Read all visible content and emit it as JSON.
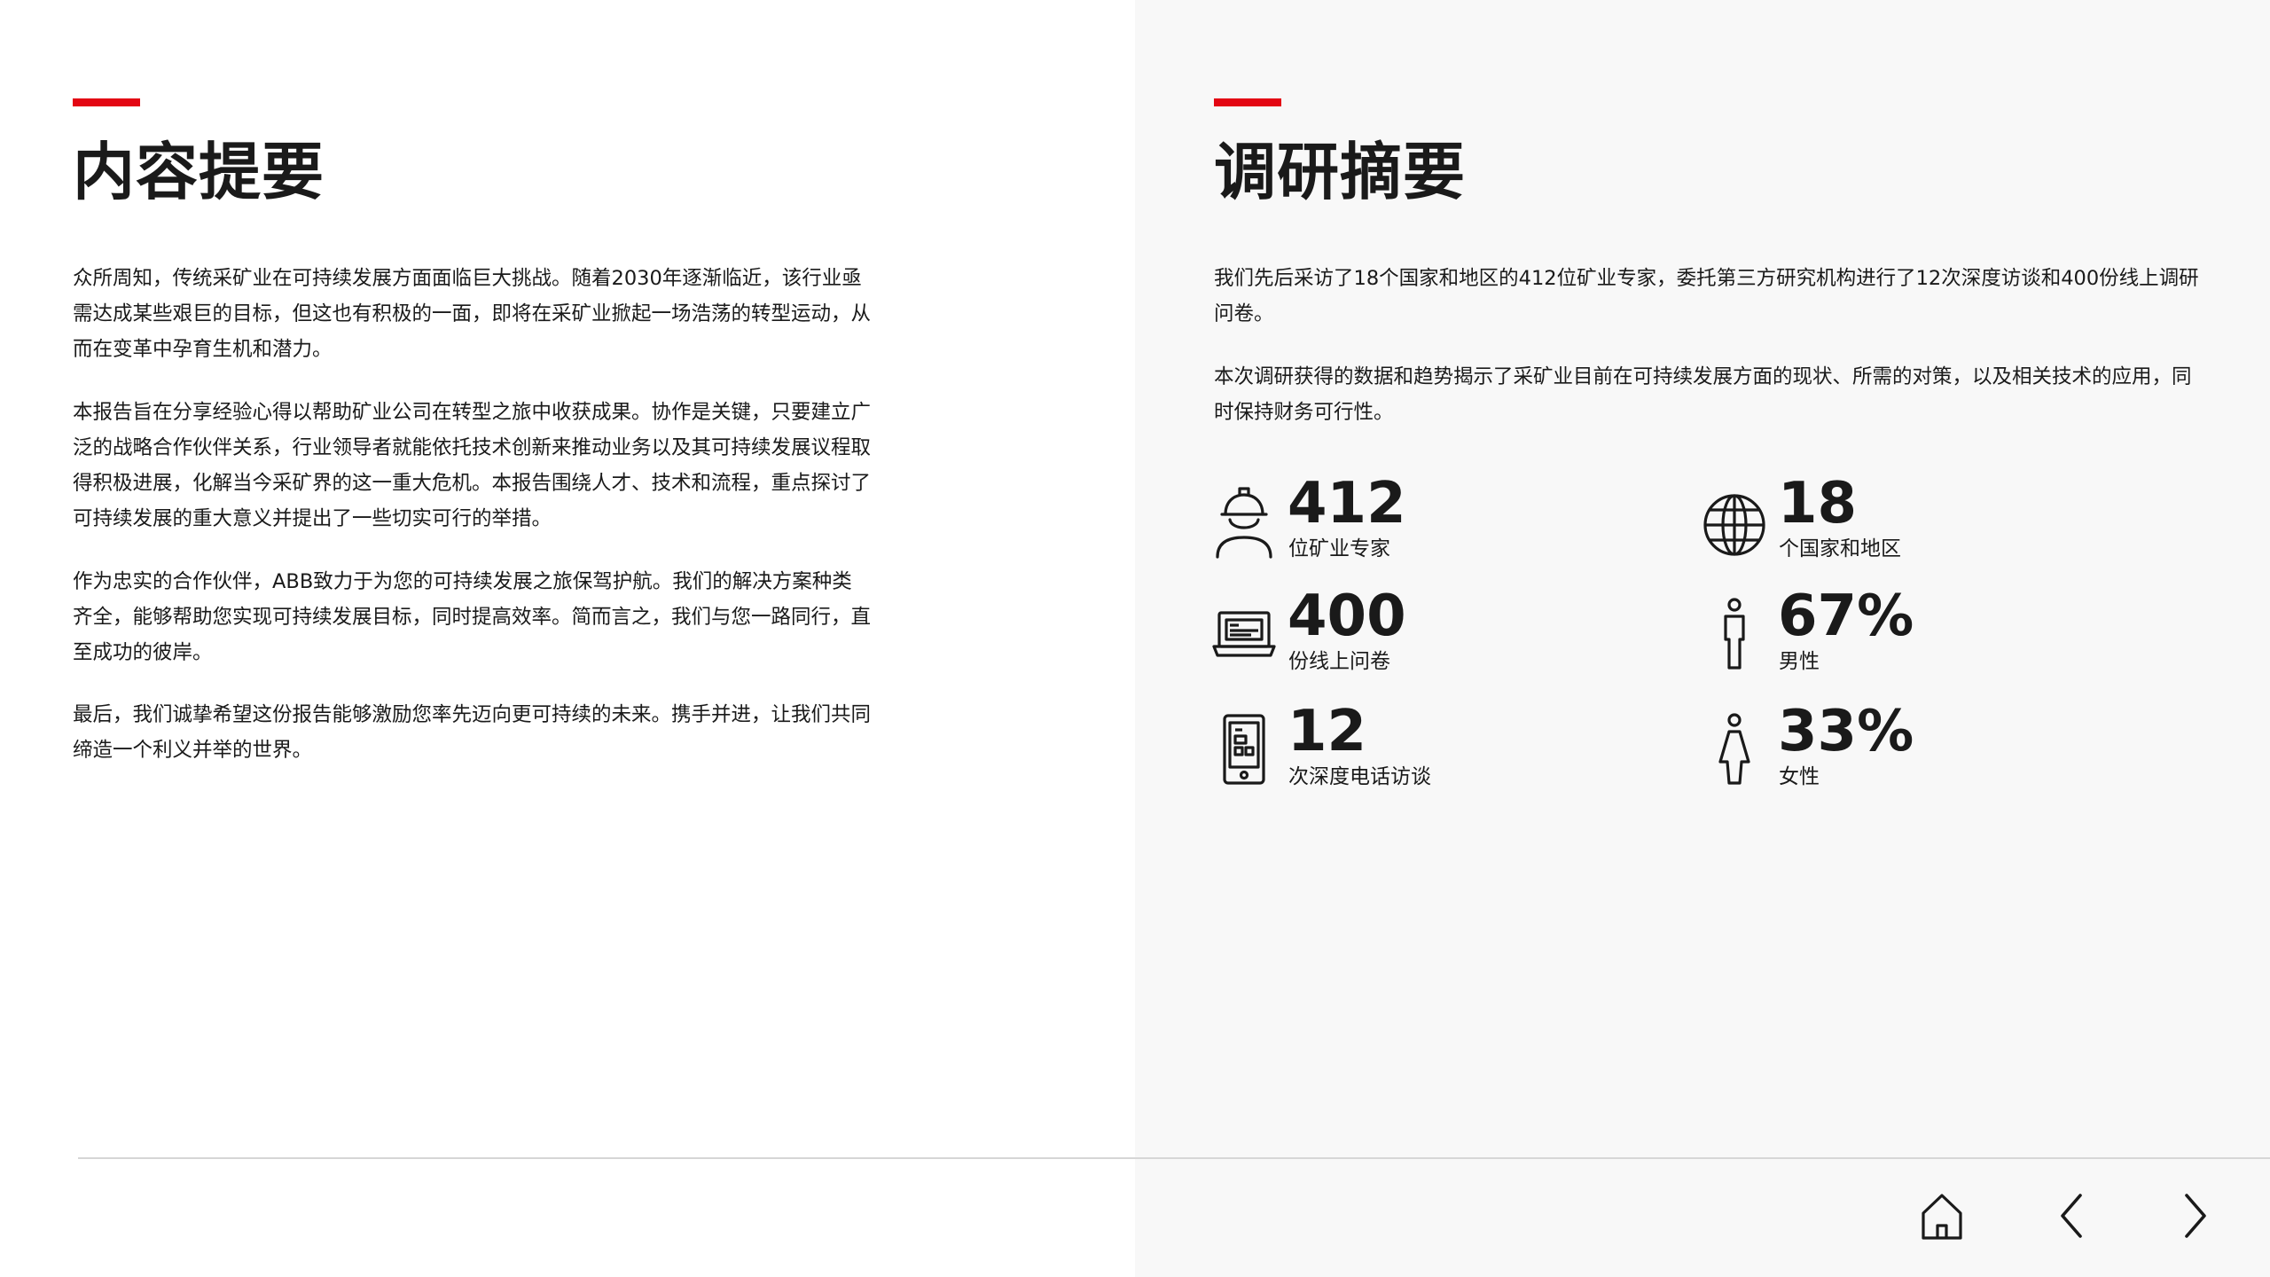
{
  "summary": {
    "title": "内容提要",
    "paragraphs": [
      "众所周知，传统采矿业在可持续发展方面面临巨大挑战。随着2030年逐渐临近，该行业亟需达成某些艰巨的目标，但这也有积极的一面，即将在采矿业掀起一场浩荡的转型运动，从而在变革中孕育生机和潜力。",
      "本报告旨在分享经验心得以帮助矿业公司在转型之旅中收获成果。协作是关键，只要建立广泛的战略合作伙伴关系，行业领导者就能依托技术创新来推动业务以及其可持续发展议程取得积极进展，化解当今采矿界的这一重大危机。本报告围绕人才、技术和流程，重点探讨了可持续发展的重大意义并提出了一些切实可行的举措。",
      "作为忠实的合作伙伴，ABB致力于为您的可持续发展之旅保驾护航。我们的解决方案种类齐全，能够帮助您实现可持续发展目标，同时提高效率。简而言之，我们与您一路同行，直至成功的彼岸。",
      "最后，我们诚挚希望这份报告能够激励您率先迈向更可持续的未来。携手并进，让我们共同缔造一个利义并举的世界。"
    ]
  },
  "survey": {
    "title": "调研摘要",
    "paragraphs": [
      "我们先后采访了18个国家和地区的412位矿业专家，委托第三方研究机构进行了12次深度访谈和400份线上调研问卷。",
      "本次调研获得的数据和趋势揭示了采矿业目前在可持续发展方面的现状、所需的对策，以及相关技术的应用，同时保持财务可行性。"
    ],
    "stats": [
      {
        "value": "412",
        "label": "位矿业专家",
        "icon": "hardhat-worker-icon"
      },
      {
        "value": "18",
        "label": "个国家和地区",
        "icon": "globe-icon"
      },
      {
        "value": "400",
        "label": "份线上问卷",
        "icon": "laptop-icon"
      },
      {
        "value": "67%",
        "label": "男性",
        "icon": "male-figure-icon"
      },
      {
        "value": "12",
        "label": "次深度电话访谈",
        "icon": "mobile-phone-icon"
      },
      {
        "value": "33%",
        "label": "女性",
        "icon": "female-figure-icon"
      }
    ]
  },
  "navigation": {
    "home": "home-icon",
    "previous": "chevron-left-icon",
    "next": "chevron-right-icon"
  },
  "colors": {
    "accent": "#e30613",
    "text": "#1a1a1a",
    "panel_bg": "#f8f8f8",
    "divider": "#d6d6d6"
  }
}
